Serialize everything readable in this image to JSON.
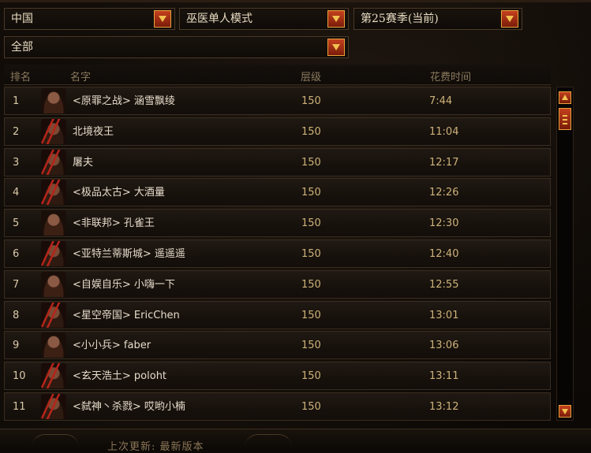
{
  "filters": {
    "region": "中国",
    "mode": "巫医单人模式",
    "season": "第25赛季(当前)",
    "category": "全部"
  },
  "columns": {
    "rank": "排名",
    "name": "名字",
    "level": "层级",
    "time": "花费时间"
  },
  "rows": [
    {
      "rank": "1",
      "name": "<原罪之战> 涵雪飘绫",
      "level": "150",
      "time": "7:44",
      "portrait": "bald"
    },
    {
      "rank": "2",
      "name": "北境夜王",
      "level": "150",
      "time": "11:04",
      "portrait": "red"
    },
    {
      "rank": "3",
      "name": "屠夫",
      "level": "150",
      "time": "12:17",
      "portrait": "red"
    },
    {
      "rank": "4",
      "name": "<极品太古> 大酒量",
      "level": "150",
      "time": "12:26",
      "portrait": "red"
    },
    {
      "rank": "5",
      "name": "<非联邦> 孔雀王",
      "level": "150",
      "time": "12:30",
      "portrait": "bald"
    },
    {
      "rank": "6",
      "name": "<亚特兰蒂斯城> 遥遥遥",
      "level": "150",
      "time": "12:40",
      "portrait": "red"
    },
    {
      "rank": "7",
      "name": "<自娱自乐> 小嗨一下",
      "level": "150",
      "time": "12:55",
      "portrait": "bald"
    },
    {
      "rank": "8",
      "name": "<星空帝国> EricChen",
      "level": "150",
      "time": "13:01",
      "portrait": "red"
    },
    {
      "rank": "9",
      "name": "<小小兵> faber",
      "level": "150",
      "time": "13:06",
      "portrait": "bald"
    },
    {
      "rank": "10",
      "name": "<玄天浩土> poloht",
      "level": "150",
      "time": "13:11",
      "portrait": "red"
    },
    {
      "rank": "11",
      "name": "<弑神丶杀戮> 哎哟小楠",
      "level": "150",
      "time": "13:12",
      "portrait": "red"
    }
  ],
  "footer": {
    "last_updated": "上次更新: 最新版本"
  },
  "colors": {
    "accent": "#c4401e",
    "gold": "#e7a23c",
    "value_text": "#cdb27a"
  },
  "icons": {
    "dropdown": "chevron-down-icon",
    "scroll_up": "arrow-up-icon",
    "scroll_down": "arrow-down-icon"
  }
}
